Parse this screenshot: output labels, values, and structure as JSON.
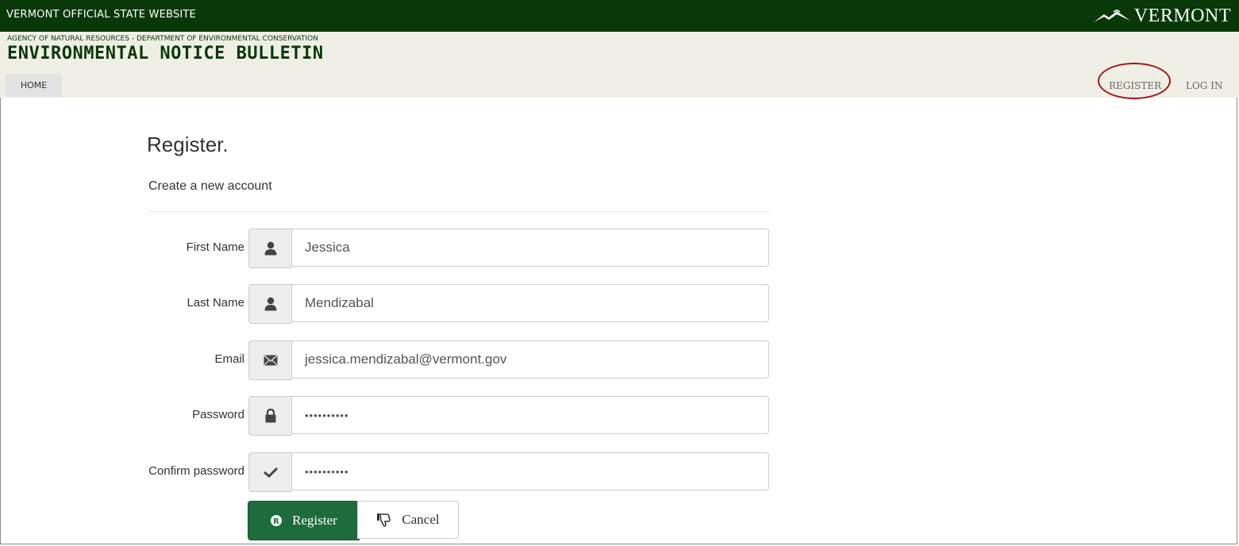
{
  "topbar": {
    "site_title": "VERMONT OFFICIAL STATE WEBSITE",
    "logo_text": "VERMONT",
    "background": "#083808"
  },
  "header": {
    "agency": "AGENCY OF NATURAL RESOURCES - DEPARTMENT OF ENVIRONMENTAL CONSERVATION",
    "bulletin": "ENVIRONMENTAL NOTICE BULLETIN",
    "background": "#f0efe6"
  },
  "nav": {
    "home": "HOME",
    "register": "REGISTER",
    "login": "LOG IN",
    "highlight_color": "#a01818"
  },
  "form": {
    "title": "Register.",
    "subtitle": "Create a new account",
    "fields": [
      {
        "label": "First Name",
        "value": "Jessica",
        "icon": "user-icon"
      },
      {
        "label": "Last Name",
        "value": "Mendizabal",
        "icon": "user-icon"
      },
      {
        "label": "Email",
        "value": "jessica.mendizabal@vermont.gov",
        "icon": "envelope-icon"
      },
      {
        "label": "Password",
        "value": "••••••••••",
        "icon": "lock-icon"
      },
      {
        "label": "Confirm password",
        "value": "••••••••••",
        "icon": "check-icon"
      }
    ],
    "register_button": "Register",
    "cancel_button": "Cancel",
    "accent": "#1e6b3c"
  }
}
